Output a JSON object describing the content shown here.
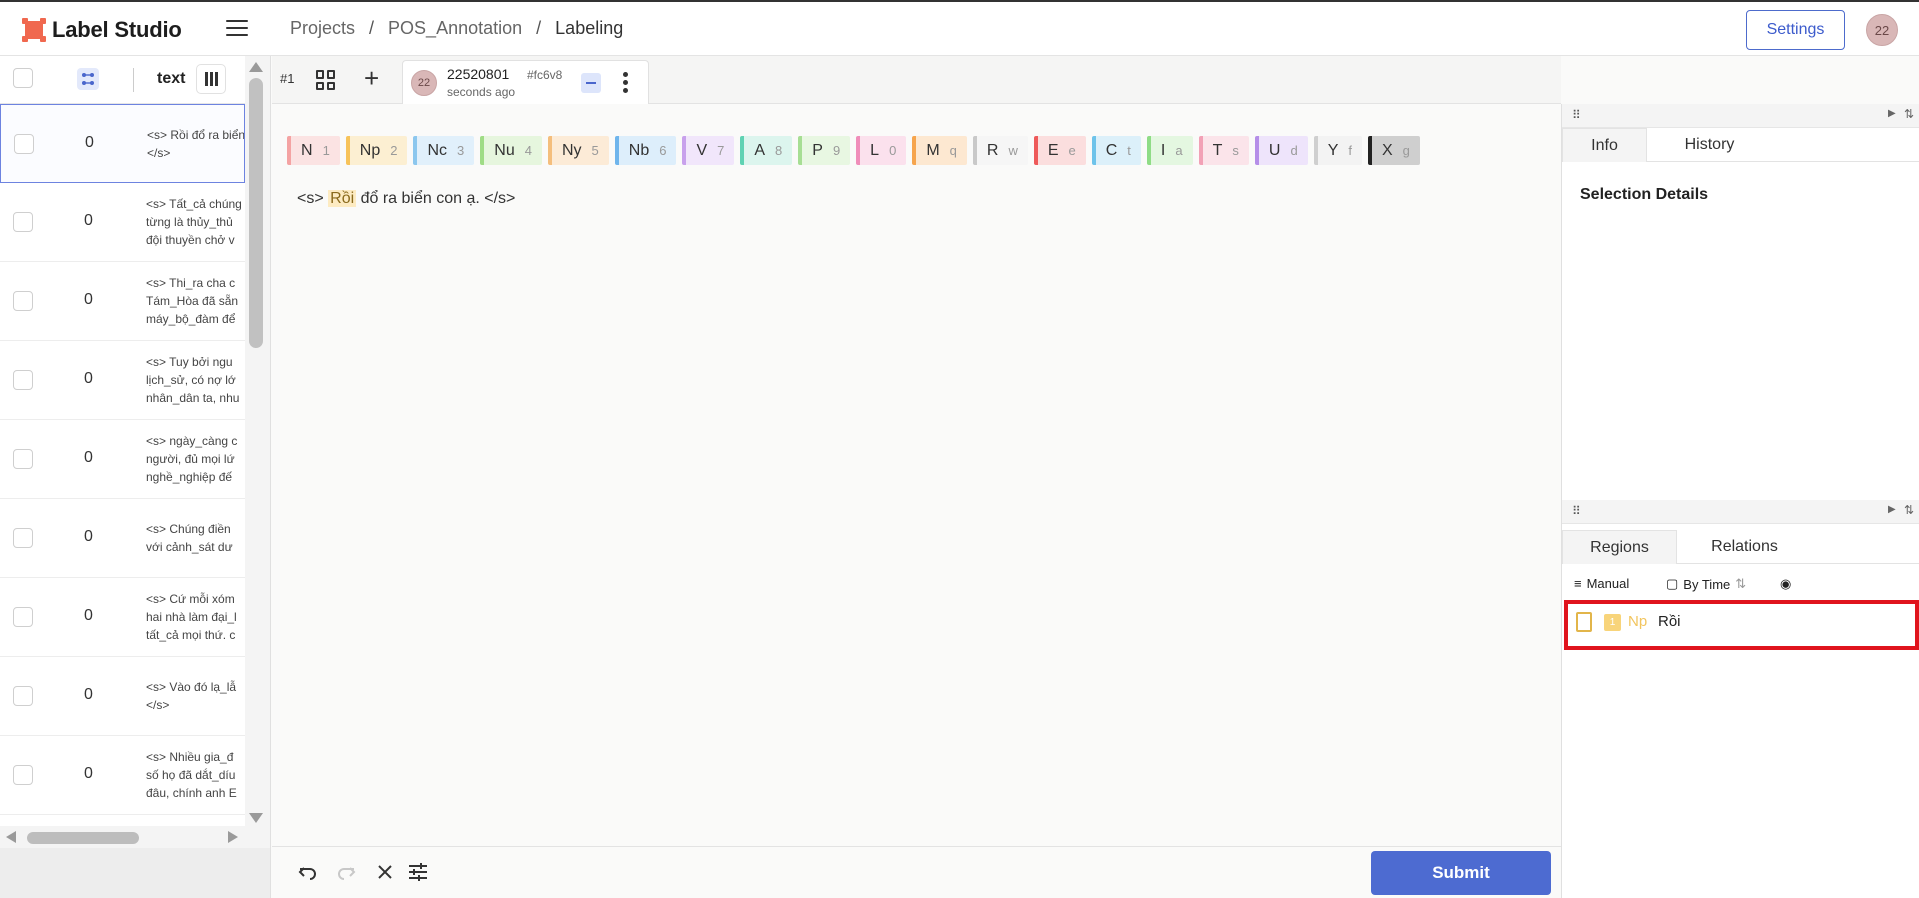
{
  "app": {
    "name": "Label Studio",
    "user_initials": "22"
  },
  "breadcrumb": [
    "Projects",
    "POS_Annotation",
    "Labeling"
  ],
  "header": {
    "settings_label": "Settings"
  },
  "tasklist": {
    "column_label": "text",
    "rows": [
      {
        "count": "0",
        "text": "<s> Rồi đổ ra biển\n</s>",
        "selected": true
      },
      {
        "count": "0",
        "text": "<s> Tất_cả chúng\ntừng là thủy_thủ\nđội thuyền chở v"
      },
      {
        "count": "0",
        "text": "<s> Thi_ra cha c\nTám_Hòa đã sẵn\nmáy_bộ_đàm để"
      },
      {
        "count": "0",
        "text": "<s> Tuy bởi ngu\nlịch_sử, có nợ lớ\nnhân_dân ta, nhu"
      },
      {
        "count": "0",
        "text": "<s> ngày_càng c\nngười, đủ mọi lứ\nnghề_nghiệp đế"
      },
      {
        "count": "0",
        "text": "<s> Chúng điền\nvới cảnh_sát dư"
      },
      {
        "count": "0",
        "text": "<s> Cứ mỗi xóm\nhai nhà làm đại_l\ntất_cả mọi thứ. c"
      },
      {
        "count": "0",
        "text": "<s> Vào đó lạ_lẫ\n</s>"
      },
      {
        "count": "0",
        "text": "<s> Nhiều gia_đ\nsố họ đã dắt_díu\nđâu, chính anh E"
      }
    ]
  },
  "annotation": {
    "id_label": "#1",
    "user": "22520801",
    "hash": "#fc6v8",
    "time": "seconds ago"
  },
  "labels": [
    {
      "name": "N",
      "key": "1",
      "color": "#f4a3a3",
      "bg": "#fbe3e3"
    },
    {
      "name": "Np",
      "key": "2",
      "color": "#f7c35a",
      "bg": "#fcefd2"
    },
    {
      "name": "Nc",
      "key": "3",
      "color": "#8cc7ee",
      "bg": "#e1f0fb"
    },
    {
      "name": "Nu",
      "key": "4",
      "color": "#9fdc86",
      "bg": "#e6f6de"
    },
    {
      "name": "Ny",
      "key": "5",
      "color": "#f4be7d",
      "bg": "#fcebd7"
    },
    {
      "name": "Nb",
      "key": "6",
      "color": "#6fb5ec",
      "bg": "#ddeefb"
    },
    {
      "name": "V",
      "key": "7",
      "color": "#c8a1ec",
      "bg": "#f1e6fb"
    },
    {
      "name": "A",
      "key": "8",
      "color": "#5fd2b3",
      "bg": "#dcf5ee"
    },
    {
      "name": "P",
      "key": "9",
      "color": "#a7de94",
      "bg": "#e8f7e2"
    },
    {
      "name": "L",
      "key": "0",
      "color": "#f08dba",
      "bg": "#fbe1ed"
    },
    {
      "name": "M",
      "key": "q",
      "color": "#f6a54e",
      "bg": "#fde8d1"
    },
    {
      "name": "R",
      "key": "w",
      "color": "#c9c9c9",
      "bg": "#f6f6f6"
    },
    {
      "name": "E",
      "key": "e",
      "color": "#ee5a5a",
      "bg": "#fbdede"
    },
    {
      "name": "C",
      "key": "t",
      "color": "#6ec3ea",
      "bg": "#dcf0fa"
    },
    {
      "name": "I",
      "key": "a",
      "color": "#8fdc86",
      "bg": "#e4f7e1"
    },
    {
      "name": "T",
      "key": "s",
      "color": "#f2a1b6",
      "bg": "#fbe4ea"
    },
    {
      "name": "U",
      "key": "d",
      "color": "#b58ee8",
      "bg": "#eee4fb"
    },
    {
      "name": "Y",
      "key": "f",
      "color": "#cfcfcf",
      "bg": "#f3f3f3"
    },
    {
      "name": "X",
      "key": "g",
      "color": "#222222",
      "bg": "#cfcfcf"
    }
  ],
  "document": {
    "before": "<s> ",
    "highlight": "Rồi",
    "after": " đổ ra biển con ạ. </s>"
  },
  "info_panel": {
    "tabs": [
      "Info",
      "History"
    ],
    "title": "Selection Details"
  },
  "regions_panel": {
    "tabs": [
      "Regions",
      "Relations"
    ],
    "manual_label": "Manual",
    "sort_label": "By Time",
    "region": {
      "index": "1",
      "label": "Np",
      "text": "Rồi"
    }
  },
  "toolbar": {
    "submit_label": "Submit"
  }
}
